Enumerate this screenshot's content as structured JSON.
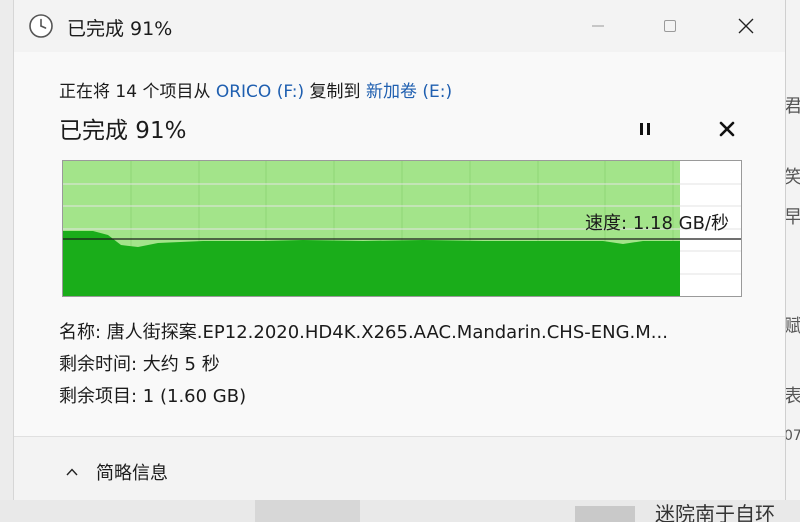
{
  "window": {
    "title": "已完成 91%"
  },
  "copy": {
    "prefix": "正在将 14 个项目从 ",
    "source": "ORICO (F:)",
    "middle": " 复制到 ",
    "destination": "新加卷 (E:)"
  },
  "progress": {
    "title": "已完成 91%",
    "percent": 91,
    "speed_label": "速度: 1.18 GB/秒"
  },
  "details": {
    "name_label": "名称: ",
    "name_value": "唐人街探案.EP12.2020.HD4K.X265.AAC.Mandarin.CHS-ENG.M...",
    "time_label": "剩余时间: ",
    "time_value": "大约 5 秒",
    "items_label": "剩余项目: ",
    "items_value": "1 (1.60 GB)"
  },
  "footer": {
    "toggle_label": "简略信息"
  },
  "colors": {
    "graph_fill": "#1aad1a",
    "graph_done_bg": "#a3e48a",
    "link": "#1f5fb0"
  },
  "background": {
    "glyphs": [
      "君",
      "笑",
      "早",
      "赋",
      "表",
      "07"
    ],
    "bottom_text": "迷院南于自环"
  }
}
